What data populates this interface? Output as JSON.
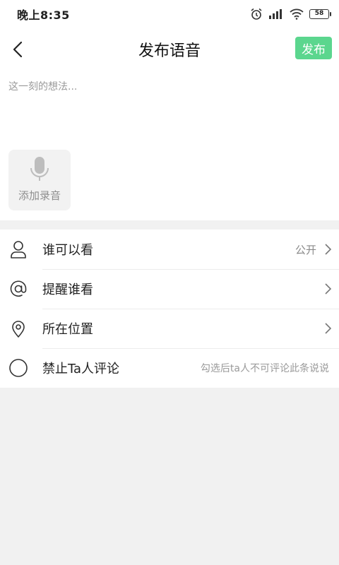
{
  "status_bar": {
    "time": "晚上8:35",
    "battery": "58"
  },
  "header": {
    "title": "发布语音",
    "publish_label": "发布"
  },
  "compose": {
    "placeholder": "这一刻的想法...",
    "add_audio_label": "添加录音"
  },
  "options": {
    "who_can_see": {
      "label": "谁可以看",
      "value": "公开"
    },
    "remind": {
      "label": "提醒谁看"
    },
    "location": {
      "label": "所在位置"
    },
    "forbid_comment": {
      "label": "禁止Ta人评论",
      "hint": "勾选后ta人不可评论此条说说"
    }
  }
}
